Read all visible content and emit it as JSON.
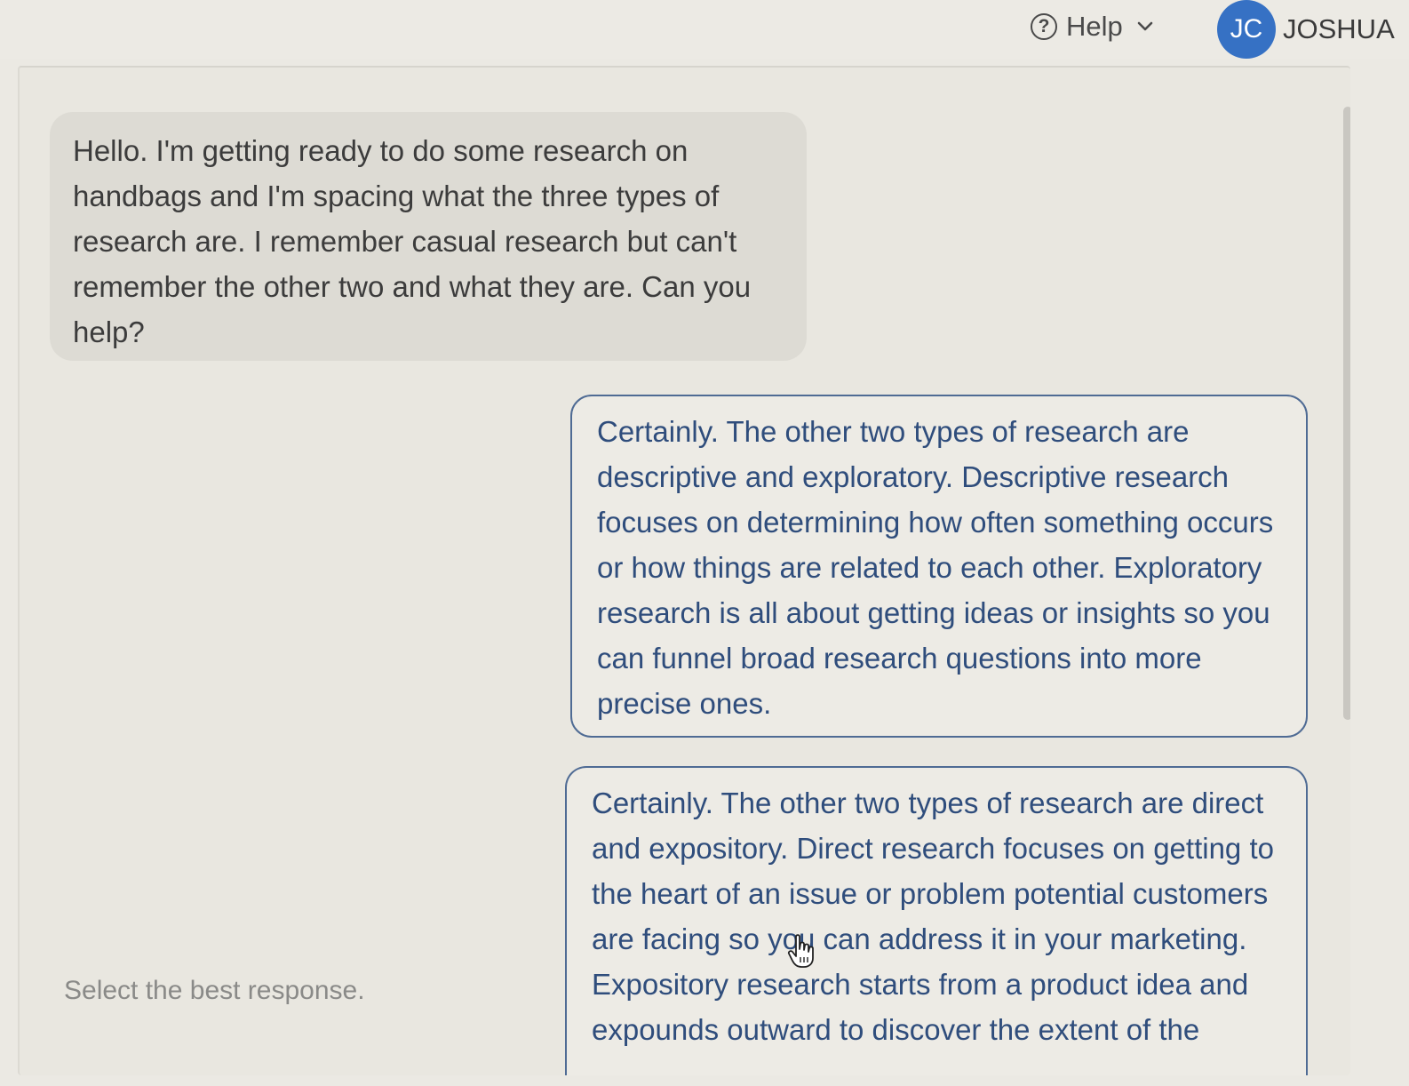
{
  "header": {
    "help_label": "Help",
    "user_initials": "JC",
    "user_name": "JOSHUA",
    "accent_color": "#3671c4"
  },
  "conversation": {
    "user_message": "Hello. I'm getting ready to do some research on handbags and I'm spacing what the three types of research are. I remember casual research but can't remember the other two and what they are. Can you help?",
    "responses": [
      {
        "text": "Certainly. The other two types of research are descriptive and exploratory. Descriptive research focuses on determining how often something occurs or how things are related to each other. Exploratory research is all about getting ideas or insights so you can funnel broad research questions into more precise ones."
      },
      {
        "text": "Certainly. The other two types of research are direct and expository. Direct research focuses on getting to the heart of an issue or problem potential customers are facing so you can address it in your marketing. Expository research starts from a product idea and expounds outward to discover the extent of the"
      }
    ]
  },
  "instructions": {
    "select_label": "Select the best response."
  },
  "icons": {
    "help": "question-circle-icon",
    "chevron": "chevron-down-icon",
    "cursor": "hand-pointer-icon"
  }
}
